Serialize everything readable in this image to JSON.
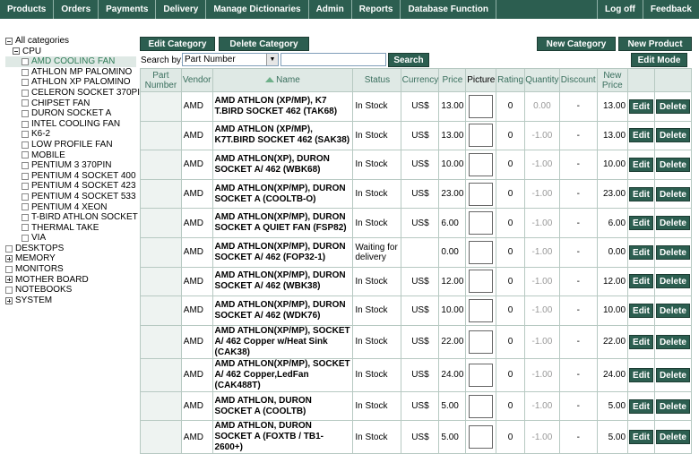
{
  "nav": {
    "items": [
      "Products",
      "Orders",
      "Payments",
      "Delivery",
      "Manage Dictionaries",
      "Admin",
      "Reports",
      "Database Function"
    ],
    "right": [
      "Log off",
      "Feedback"
    ]
  },
  "tree": {
    "root": "All categories",
    "cpu": "CPU",
    "cpu_children": [
      "AMD COOLING FAN",
      "ATHLON MP PALOMINO",
      "ATHLON XP PALOMINO",
      "CELERON SOCKET 370PI",
      "CHIPSET FAN",
      "DURON SOCKET A",
      "INTEL COOLING FAN",
      "K6-2",
      "LOW PROFILE FAN",
      "MOBILE",
      "PENTIUM 3 370PIN",
      "PENTIUM 4 SOCKET 400",
      "PENTIUM 4 SOCKET 423",
      "PENTIUM 4 SOCKET 533",
      "PENTIUM 4 XEON",
      "T-BIRD ATHLON SOCKET",
      "THERMAL TAKE",
      "VIA"
    ],
    "others": [
      {
        "label": "DESKTOPS",
        "expandable": false
      },
      {
        "label": "MEMORY",
        "expandable": true
      },
      {
        "label": "MONITORS",
        "expandable": false
      },
      {
        "label": "MOTHER BOARD",
        "expandable": true
      },
      {
        "label": "NOTEBOOKS",
        "expandable": false
      },
      {
        "label": "SYSTEM",
        "expandable": true
      }
    ]
  },
  "toolbar": {
    "edit_category": "Edit Category",
    "delete_category": "Delete Category",
    "new_category": "New Category",
    "new_product": "New Product",
    "edit_mode": "Edit Mode",
    "search_by_label": "Search by:",
    "search_by_value": "Part Number",
    "search_input_value": "",
    "search_button": "Search"
  },
  "table": {
    "headers": {
      "part": "Part Number",
      "vendor": "Vendor",
      "name": "Name",
      "status": "Status",
      "currency": "Currency",
      "price": "Price",
      "picture": "Picture",
      "rating": "Rating",
      "quantity": "Quantity",
      "discount": "Discount",
      "newprice": "New Price"
    },
    "edit_label": "Edit",
    "delete_label": "Delete",
    "rows": [
      {
        "part": "",
        "vendor": "AMD",
        "name": "AMD ATHLON (XP/MP), K7 T.BIRD SOCKET 462 (TAK68)",
        "status": "In Stock",
        "currency": "US$",
        "price": "13.00",
        "rating": "0",
        "quantity": "0.00",
        "discount": "-",
        "newprice": "13.00"
      },
      {
        "part": "",
        "vendor": "AMD",
        "name": "AMD ATHLON (XP/MP), K7T.BIRD SOCKET 462 (SAK38)",
        "status": "In Stock",
        "currency": "US$",
        "price": "13.00",
        "rating": "0",
        "quantity": "-1.00",
        "discount": "-",
        "newprice": "13.00"
      },
      {
        "part": "",
        "vendor": "AMD",
        "name": "AMD ATHLON(XP), DURON SOCKET A/ 462 (WBK68)",
        "status": "In Stock",
        "currency": "US$",
        "price": "10.00",
        "rating": "0",
        "quantity": "-1.00",
        "discount": "-",
        "newprice": "10.00"
      },
      {
        "part": "",
        "vendor": "AMD",
        "name": "AMD ATHLON(XP/MP), DURON SOCKET A (COOLTB-O)",
        "status": "In Stock",
        "currency": "US$",
        "price": "23.00",
        "rating": "0",
        "quantity": "-1.00",
        "discount": "-",
        "newprice": "23.00"
      },
      {
        "part": "",
        "vendor": "AMD",
        "name": "AMD ATHLON(XP/MP), DURON SOCKET A QUIET FAN (FSP82)",
        "status": "In Stock",
        "currency": "US$",
        "price": "6.00",
        "rating": "0",
        "quantity": "-1.00",
        "discount": "-",
        "newprice": "6.00"
      },
      {
        "part": "",
        "vendor": "AMD",
        "name": "AMD ATHLON(XP/MP), DURON SOCKET A/ 462 (FOP32-1)",
        "status": "Waiting for delivery",
        "currency": "",
        "price": "0.00",
        "rating": "0",
        "quantity": "-1.00",
        "discount": "-",
        "newprice": "0.00"
      },
      {
        "part": "",
        "vendor": "AMD",
        "name": "AMD ATHLON(XP/MP), DURON SOCKET A/ 462 (WBK38)",
        "status": "In Stock",
        "currency": "US$",
        "price": "12.00",
        "rating": "0",
        "quantity": "-1.00",
        "discount": "-",
        "newprice": "12.00"
      },
      {
        "part": "",
        "vendor": "AMD",
        "name": "AMD ATHLON(XP/MP), DURON SOCKET A/ 462 (WDK76)",
        "status": "In Stock",
        "currency": "US$",
        "price": "10.00",
        "rating": "0",
        "quantity": "-1.00",
        "discount": "-",
        "newprice": "10.00"
      },
      {
        "part": "",
        "vendor": "AMD",
        "name": "AMD ATHLON(XP/MP), SOCKET A/ 462 Copper w/Heat Sink (CAK38)",
        "status": "In Stock",
        "currency": "US$",
        "price": "22.00",
        "rating": "0",
        "quantity": "-1.00",
        "discount": "-",
        "newprice": "22.00"
      },
      {
        "part": "",
        "vendor": "AMD",
        "name": "AMD ATHLON(XP/MP), SOCKET A/ 462 Copper,LedFan (CAK488T)",
        "status": "In Stock",
        "currency": "US$",
        "price": "24.00",
        "rating": "0",
        "quantity": "-1.00",
        "discount": "-",
        "newprice": "24.00"
      },
      {
        "part": "",
        "vendor": "AMD",
        "name": "AMD ATHLON, DURON SOCKET A (COOLTB)",
        "status": "In Stock",
        "currency": "US$",
        "price": "5.00",
        "rating": "0",
        "quantity": "-1.00",
        "discount": "-",
        "newprice": "5.00"
      },
      {
        "part": "",
        "vendor": "AMD",
        "name": "AMD ATHLON, DURON SOCKET A (FOXTB / TB1-2600+)",
        "status": "In Stock",
        "currency": "US$",
        "price": "5.00",
        "rating": "0",
        "quantity": "-1.00",
        "discount": "-",
        "newprice": "5.00"
      }
    ]
  }
}
